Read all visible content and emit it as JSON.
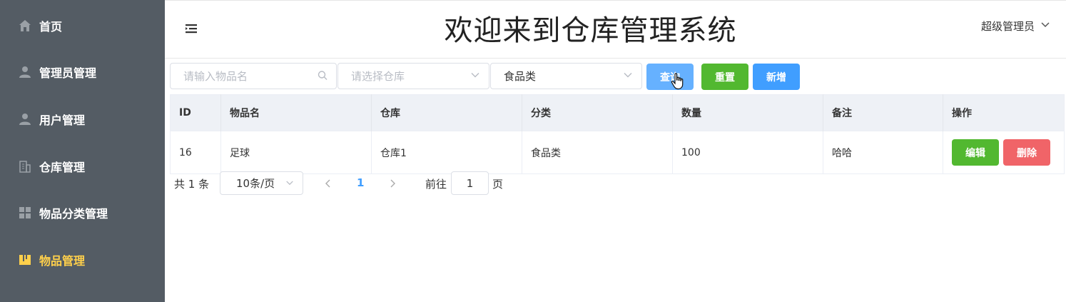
{
  "sidebar": {
    "items": [
      {
        "label": "首页",
        "icon": "home-icon"
      },
      {
        "label": "管理员管理",
        "icon": "user-icon"
      },
      {
        "label": "用户管理",
        "icon": "user-icon"
      },
      {
        "label": "仓库管理",
        "icon": "building-icon"
      },
      {
        "label": "物品分类管理",
        "icon": "grid-icon"
      },
      {
        "label": "物品管理",
        "icon": "goods-icon",
        "active": true
      }
    ]
  },
  "header": {
    "title": "欢迎来到仓库管理系统",
    "user": "超级管理员"
  },
  "filters": {
    "name_placeholder": "请输入物品名",
    "storage_placeholder": "请选择仓库",
    "category_value": "食品类"
  },
  "toolbar": {
    "search_label": "查询",
    "reset_label": "重置",
    "add_label": "新增"
  },
  "table": {
    "headers": [
      "ID",
      "物品名",
      "仓库",
      "分类",
      "数量",
      "备注",
      "操作"
    ],
    "rows": [
      {
        "id": "16",
        "name": "足球",
        "storage": "仓库1",
        "category": "食品类",
        "count": "100",
        "remark": "哈哈"
      }
    ],
    "edit_label": "编辑",
    "delete_label": "删除"
  },
  "pagination": {
    "total": "共 1 条",
    "page_size": "10条/页",
    "current_page": "1",
    "goto_label": "前往",
    "goto_value": "1",
    "page_suffix": "页"
  },
  "colors": {
    "sidebar_bg": "#545c64",
    "active_text": "#ffd04b",
    "primary": "#409eff",
    "success": "#52b830",
    "danger": "#f06468"
  }
}
